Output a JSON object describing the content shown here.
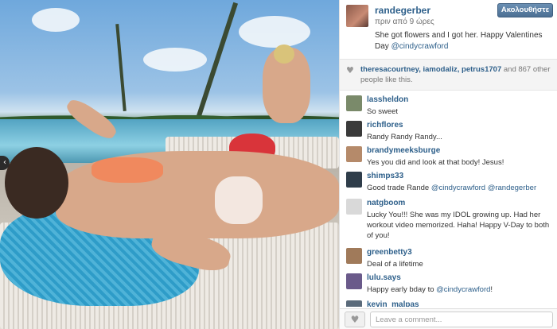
{
  "post": {
    "username": "randegerber",
    "time": "πριν από 9 ώρες",
    "caption_text": "She got flowers and I got her. Happy Valentines Day",
    "caption_mention": "@cindycrawford",
    "follow_label": "Ακολουθήστε"
  },
  "likes": {
    "names": "theresacourtney, iamodaliz, petrus1707",
    "rest": "and 867 other people like this."
  },
  "comments": [
    {
      "user": "lassheldon",
      "text": "So sweet",
      "mention": "",
      "after": ""
    },
    {
      "user": "richflores",
      "text": "Randy Randy Randy...",
      "mention": "",
      "after": ""
    },
    {
      "user": "brandymeeksburge",
      "text": "Yes you did and look at that body! Jesus!",
      "mention": "",
      "after": ""
    },
    {
      "user": "shimps33",
      "text": "Good trade Rande ",
      "mention": "@cindycrawford @randegerber",
      "after": ""
    },
    {
      "user": "natgboom",
      "text": "Lucky You!!! She was my IDOL growing up. Had her workout video memorized. Haha! Happy V-Day to both of you!",
      "mention": "",
      "after": ""
    },
    {
      "user": "greenbetty3",
      "text": "Deal of a lifetime",
      "mention": "",
      "after": ""
    },
    {
      "user": "lulu.says",
      "text": "Happy early bday to ",
      "mention": "@cindycrawford",
      "after": "!"
    },
    {
      "user": "kevin_malpas",
      "text": "",
      "mention": "",
      "after": ""
    }
  ],
  "footer": {
    "comment_placeholder": "Leave a comment..."
  },
  "icons": {
    "likes_heart": "heart-icon",
    "like_button": "heart-icon",
    "prev": "chevron-left-icon"
  }
}
